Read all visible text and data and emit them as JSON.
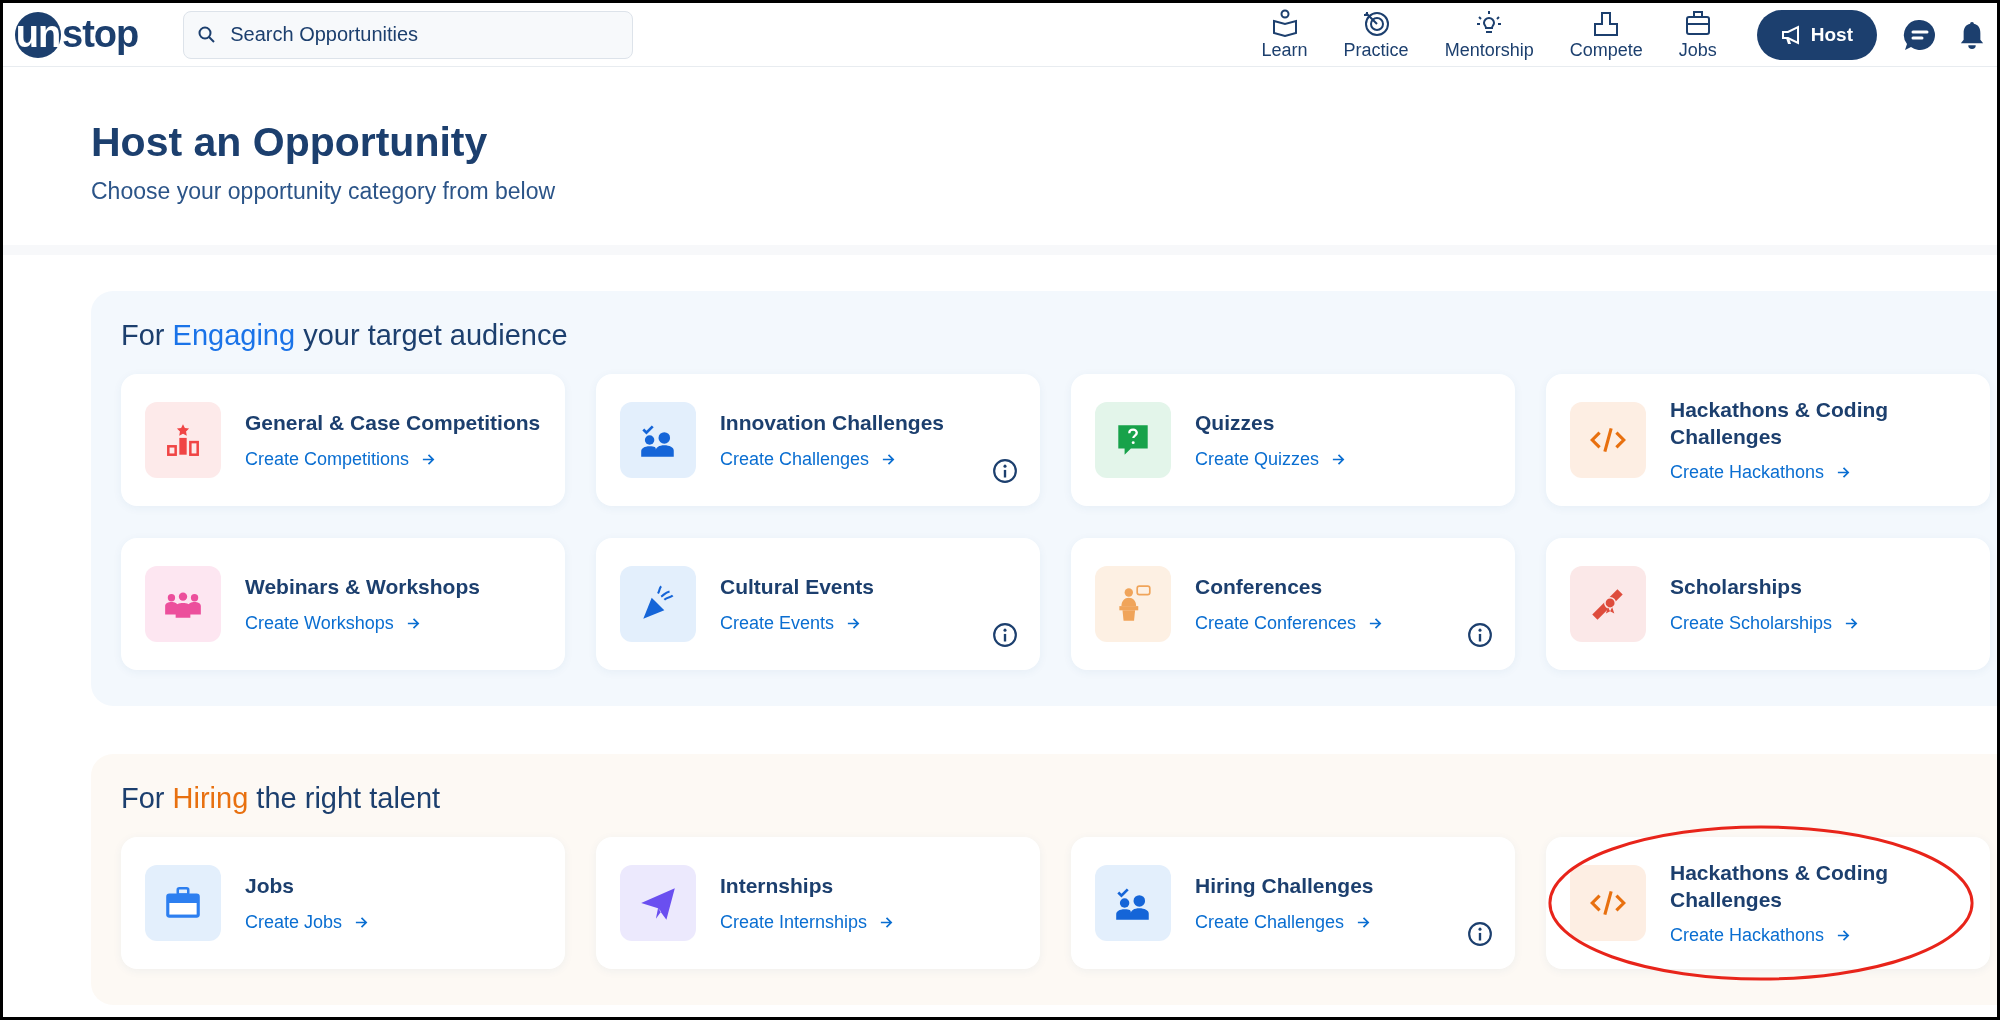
{
  "header": {
    "logo": {
      "badge": "un",
      "rest": "stop"
    },
    "search": {
      "placeholder": "Search Opportunities"
    },
    "nav": [
      {
        "label": "Learn",
        "kind": "reader"
      },
      {
        "label": "Practice",
        "kind": "target"
      },
      {
        "label": "Mentorship",
        "kind": "bulb"
      },
      {
        "label": "Compete",
        "kind": "podium"
      },
      {
        "label": "Jobs",
        "kind": "briefcase"
      }
    ],
    "host_button": "Host"
  },
  "page": {
    "title": "Host an Opportunity",
    "subtitle": "Choose your opportunity category from below"
  },
  "sections": [
    {
      "before": "For ",
      "highlight": "Engaging",
      "after": " your target audience",
      "color": "#1a73e8",
      "cards": [
        {
          "title": "General & Case Competitions",
          "link": "Create Competitions",
          "kind": "podium",
          "info": false,
          "circled": false
        },
        {
          "title": "Innovation Challenges",
          "link": "Create Challenges",
          "kind": "team",
          "info": true,
          "circled": false
        },
        {
          "title": "Quizzes",
          "link": "Create Quizzes",
          "kind": "quiz",
          "info": false,
          "circled": false
        },
        {
          "title": "Hackathons & Coding Challenges",
          "link": "Create Hackathons",
          "kind": "code",
          "info": false,
          "circled": false
        },
        {
          "title": "Webinars & Workshops",
          "link": "Create Workshops",
          "kind": "group",
          "info": false,
          "circled": false
        },
        {
          "title": "Cultural Events",
          "link": "Create Events",
          "kind": "popper",
          "info": true,
          "circled": false
        },
        {
          "title": "Conferences",
          "link": "Create Conferences",
          "kind": "speaker",
          "info": true,
          "circled": false
        },
        {
          "title": "Scholarships",
          "link": "Create Scholarships",
          "kind": "scroll",
          "info": false,
          "circled": false
        }
      ]
    },
    {
      "before": "For ",
      "highlight": "Hiring",
      "after": " the right talent",
      "color": "#e8700f",
      "cards": [
        {
          "title": "Jobs",
          "link": "Create Jobs",
          "kind": "briefcase",
          "info": false,
          "circled": false
        },
        {
          "title": "Internships",
          "link": "Create Internships",
          "kind": "plane",
          "info": false,
          "circled": false
        },
        {
          "title": "Hiring Challenges",
          "link": "Create Challenges",
          "kind": "team",
          "info": true,
          "circled": false
        },
        {
          "title": "Hackathons & Coding Challenges",
          "link": "Create Hackathons",
          "kind": "code",
          "info": false,
          "circled": true
        }
      ]
    }
  ]
}
